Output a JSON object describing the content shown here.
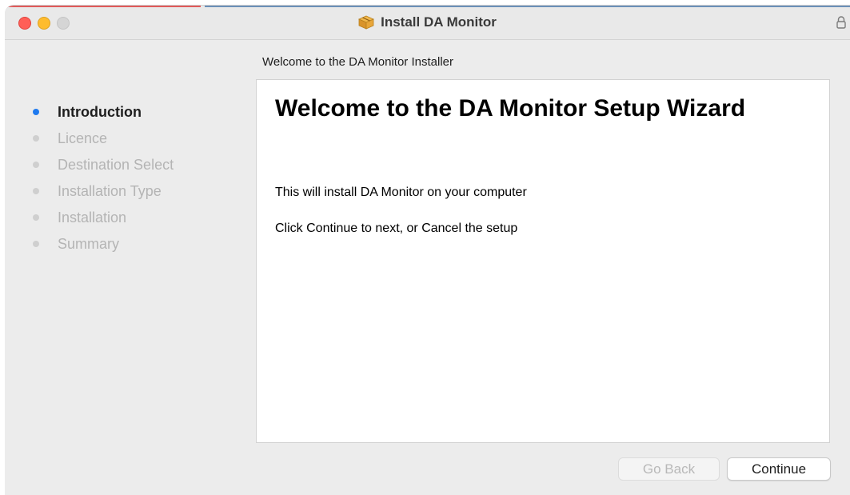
{
  "window": {
    "title": "Install DA Monitor",
    "title_icon": "package-icon",
    "lock_icon": "lock-icon"
  },
  "subtitle": "Welcome to the DA Monitor Installer",
  "steps": [
    {
      "label": "Introduction",
      "active": true
    },
    {
      "label": "Licence",
      "active": false
    },
    {
      "label": "Destination Select",
      "active": false
    },
    {
      "label": "Installation Type",
      "active": false
    },
    {
      "label": "Installation",
      "active": false
    },
    {
      "label": "Summary",
      "active": false
    }
  ],
  "content": {
    "heading": "Welcome to the DA Monitor Setup Wizard",
    "line1": "This will install DA Monitor on your computer",
    "line2": "Click Continue to next, or Cancel  the setup"
  },
  "buttons": {
    "back": "Go Back",
    "continue": "Continue"
  },
  "colors": {
    "active_step": "#1f7aef",
    "close": "#ff5f57",
    "minimize": "#febc2e",
    "zoom_disabled": "#d5d5d5"
  }
}
